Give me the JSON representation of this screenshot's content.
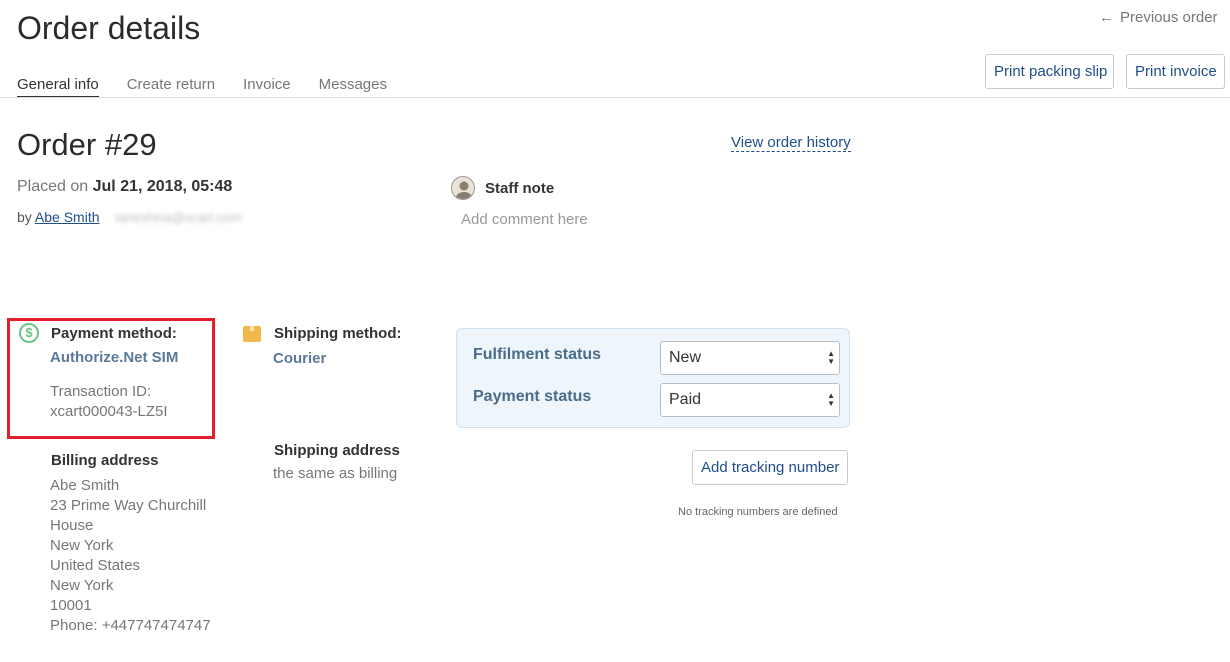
{
  "header": {
    "title": "Order details",
    "prev_arrow": "←",
    "prev_order": "Previous order"
  },
  "tabs": [
    {
      "label": "General info",
      "active": true
    },
    {
      "label": "Create return",
      "active": false
    },
    {
      "label": "Invoice",
      "active": false
    },
    {
      "label": "Messages",
      "active": false
    }
  ],
  "buttons": {
    "print_packing_slip": "Print packing slip",
    "print_invoice": "Print invoice",
    "add_tracking": "Add tracking number"
  },
  "order": {
    "number": "Order #29",
    "view_history": "View order history",
    "placed_prefix": "Placed on",
    "placed_date": "Jul 21, 2018, 05:48",
    "by_prefix": "by",
    "customer_name": "Abe Smith",
    "customer_email": "taneshina@xcart.com"
  },
  "staff_note": {
    "label": "Staff note",
    "placeholder": "Add comment here"
  },
  "payment": {
    "label": "Payment method:",
    "method": "Authorize.Net SIM",
    "transaction_label": "Transaction ID:",
    "transaction_id": "xcart000043-LZ5I"
  },
  "shipping": {
    "label": "Shipping method:",
    "method": "Courier",
    "address_label": "Shipping address",
    "address_value": "the same as billing"
  },
  "status": {
    "fulfilment_label": "Fulfilment status",
    "fulfilment_value": "New",
    "payment_label": "Payment status",
    "payment_value": "Paid"
  },
  "tracking": {
    "empty_text": "No tracking numbers are defined"
  },
  "billing": {
    "label": "Billing address",
    "lines": [
      "Abe Smith",
      "23 Prime Way Churchill",
      "House",
      "New York",
      "United States",
      "New York",
      "10001",
      "Phone: +447747474747"
    ]
  },
  "colors": {
    "highlight": "#e41e2c",
    "link": "#1f4e8a",
    "status_panel_bg": "#eef6fc"
  }
}
